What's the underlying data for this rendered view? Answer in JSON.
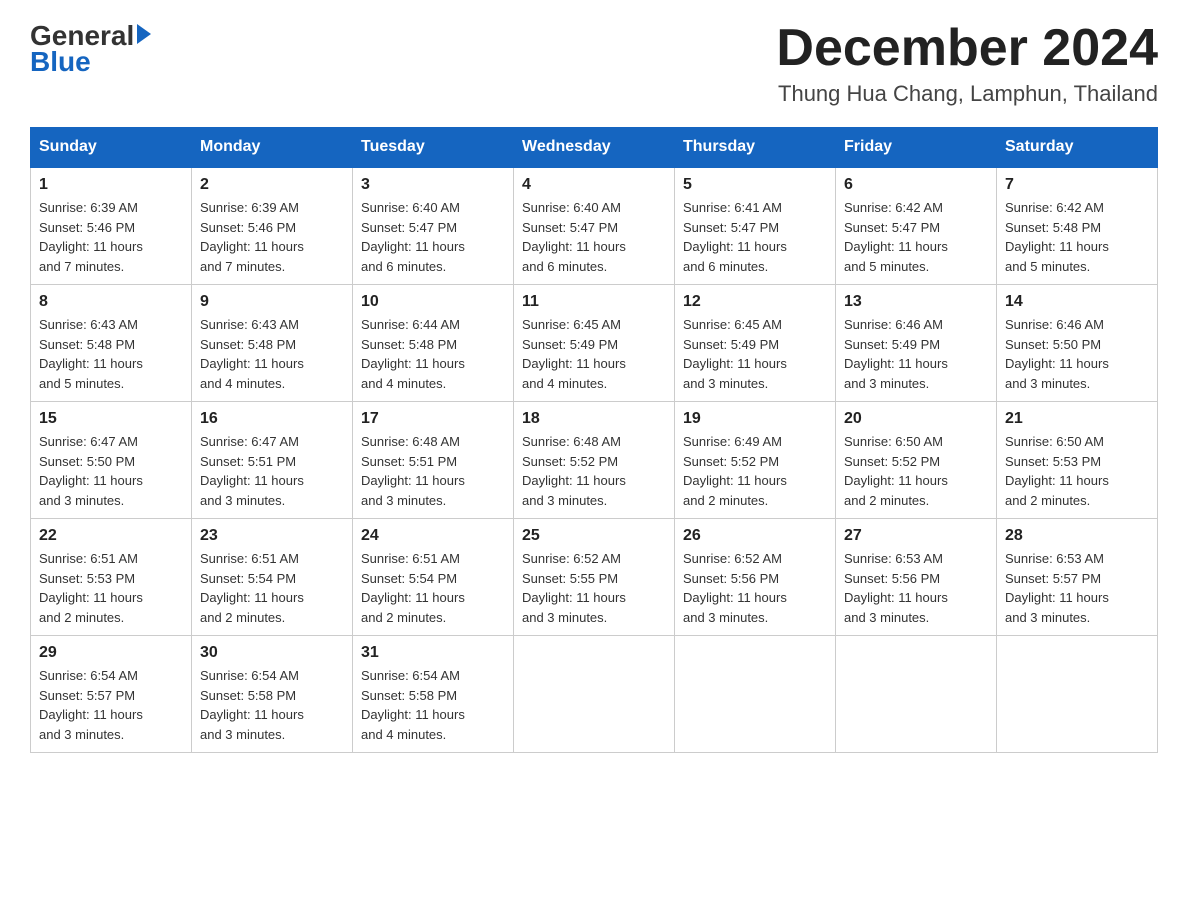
{
  "header": {
    "logo_general": "General",
    "logo_blue": "Blue",
    "main_title": "December 2024",
    "subtitle": "Thung Hua Chang, Lamphun, Thailand"
  },
  "weekdays": [
    "Sunday",
    "Monday",
    "Tuesday",
    "Wednesday",
    "Thursday",
    "Friday",
    "Saturday"
  ],
  "weeks": [
    [
      {
        "day": "1",
        "sunrise": "6:39 AM",
        "sunset": "5:46 PM",
        "daylight": "11 hours and 7 minutes."
      },
      {
        "day": "2",
        "sunrise": "6:39 AM",
        "sunset": "5:46 PM",
        "daylight": "11 hours and 7 minutes."
      },
      {
        "day": "3",
        "sunrise": "6:40 AM",
        "sunset": "5:47 PM",
        "daylight": "11 hours and 6 minutes."
      },
      {
        "day": "4",
        "sunrise": "6:40 AM",
        "sunset": "5:47 PM",
        "daylight": "11 hours and 6 minutes."
      },
      {
        "day": "5",
        "sunrise": "6:41 AM",
        "sunset": "5:47 PM",
        "daylight": "11 hours and 6 minutes."
      },
      {
        "day": "6",
        "sunrise": "6:42 AM",
        "sunset": "5:47 PM",
        "daylight": "11 hours and 5 minutes."
      },
      {
        "day": "7",
        "sunrise": "6:42 AM",
        "sunset": "5:48 PM",
        "daylight": "11 hours and 5 minutes."
      }
    ],
    [
      {
        "day": "8",
        "sunrise": "6:43 AM",
        "sunset": "5:48 PM",
        "daylight": "11 hours and 5 minutes."
      },
      {
        "day": "9",
        "sunrise": "6:43 AM",
        "sunset": "5:48 PM",
        "daylight": "11 hours and 4 minutes."
      },
      {
        "day": "10",
        "sunrise": "6:44 AM",
        "sunset": "5:48 PM",
        "daylight": "11 hours and 4 minutes."
      },
      {
        "day": "11",
        "sunrise": "6:45 AM",
        "sunset": "5:49 PM",
        "daylight": "11 hours and 4 minutes."
      },
      {
        "day": "12",
        "sunrise": "6:45 AM",
        "sunset": "5:49 PM",
        "daylight": "11 hours and 3 minutes."
      },
      {
        "day": "13",
        "sunrise": "6:46 AM",
        "sunset": "5:49 PM",
        "daylight": "11 hours and 3 minutes."
      },
      {
        "day": "14",
        "sunrise": "6:46 AM",
        "sunset": "5:50 PM",
        "daylight": "11 hours and 3 minutes."
      }
    ],
    [
      {
        "day": "15",
        "sunrise": "6:47 AM",
        "sunset": "5:50 PM",
        "daylight": "11 hours and 3 minutes."
      },
      {
        "day": "16",
        "sunrise": "6:47 AM",
        "sunset": "5:51 PM",
        "daylight": "11 hours and 3 minutes."
      },
      {
        "day": "17",
        "sunrise": "6:48 AM",
        "sunset": "5:51 PM",
        "daylight": "11 hours and 3 minutes."
      },
      {
        "day": "18",
        "sunrise": "6:48 AM",
        "sunset": "5:52 PM",
        "daylight": "11 hours and 3 minutes."
      },
      {
        "day": "19",
        "sunrise": "6:49 AM",
        "sunset": "5:52 PM",
        "daylight": "11 hours and 2 minutes."
      },
      {
        "day": "20",
        "sunrise": "6:50 AM",
        "sunset": "5:52 PM",
        "daylight": "11 hours and 2 minutes."
      },
      {
        "day": "21",
        "sunrise": "6:50 AM",
        "sunset": "5:53 PM",
        "daylight": "11 hours and 2 minutes."
      }
    ],
    [
      {
        "day": "22",
        "sunrise": "6:51 AM",
        "sunset": "5:53 PM",
        "daylight": "11 hours and 2 minutes."
      },
      {
        "day": "23",
        "sunrise": "6:51 AM",
        "sunset": "5:54 PM",
        "daylight": "11 hours and 2 minutes."
      },
      {
        "day": "24",
        "sunrise": "6:51 AM",
        "sunset": "5:54 PM",
        "daylight": "11 hours and 2 minutes."
      },
      {
        "day": "25",
        "sunrise": "6:52 AM",
        "sunset": "5:55 PM",
        "daylight": "11 hours and 3 minutes."
      },
      {
        "day": "26",
        "sunrise": "6:52 AM",
        "sunset": "5:56 PM",
        "daylight": "11 hours and 3 minutes."
      },
      {
        "day": "27",
        "sunrise": "6:53 AM",
        "sunset": "5:56 PM",
        "daylight": "11 hours and 3 minutes."
      },
      {
        "day": "28",
        "sunrise": "6:53 AM",
        "sunset": "5:57 PM",
        "daylight": "11 hours and 3 minutes."
      }
    ],
    [
      {
        "day": "29",
        "sunrise": "6:54 AM",
        "sunset": "5:57 PM",
        "daylight": "11 hours and 3 minutes."
      },
      {
        "day": "30",
        "sunrise": "6:54 AM",
        "sunset": "5:58 PM",
        "daylight": "11 hours and 3 minutes."
      },
      {
        "day": "31",
        "sunrise": "6:54 AM",
        "sunset": "5:58 PM",
        "daylight": "11 hours and 4 minutes."
      },
      null,
      null,
      null,
      null
    ]
  ],
  "labels": {
    "sunrise_prefix": "Sunrise: ",
    "sunset_prefix": "Sunset: ",
    "daylight_prefix": "Daylight: "
  }
}
